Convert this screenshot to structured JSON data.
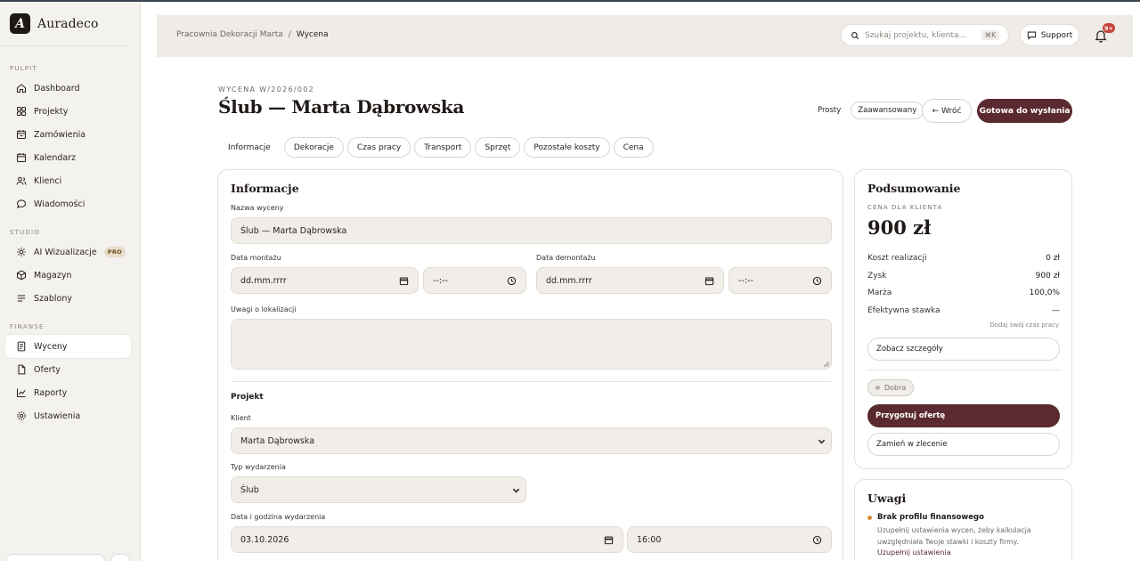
{
  "brand": {
    "logo_letter": "A",
    "name": "Auradeco"
  },
  "sidebar": {
    "sections": [
      {
        "label": "PULPIT",
        "items": [
          {
            "label": "Dashboard",
            "icon": "home-icon"
          },
          {
            "label": "Projekty",
            "icon": "grid-icon"
          },
          {
            "label": "Zamówienia",
            "icon": "box-icon"
          },
          {
            "label": "Kalendarz",
            "icon": "calendar-icon"
          },
          {
            "label": "Klienci",
            "icon": "users-icon"
          },
          {
            "label": "Wiadomości",
            "icon": "chat-icon"
          }
        ]
      },
      {
        "label": "STUDIO",
        "items": [
          {
            "label": "AI Wizualizacje",
            "icon": "sparkle-icon",
            "badge": "PRO"
          },
          {
            "label": "Magazyn",
            "icon": "package-icon"
          },
          {
            "label": "Szablony",
            "icon": "lines-icon"
          }
        ]
      },
      {
        "label": "FINANSE",
        "items": [
          {
            "label": "Wyceny",
            "icon": "document-icon",
            "active": true
          },
          {
            "label": "Oferty",
            "icon": "file-icon"
          },
          {
            "label": "Raporty",
            "icon": "chart-icon"
          },
          {
            "label": "Ustawienia",
            "icon": "gear-icon"
          }
        ]
      }
    ]
  },
  "header": {
    "breadcrumb": [
      "Pracownia Dekoracji Marta",
      "Wycena"
    ],
    "breadcrumb_sep": "/",
    "search_placeholder": "Szukaj projektu, klienta...",
    "search_kbd": "⌘K",
    "support_label": "Support",
    "notification_badge": "9+"
  },
  "page": {
    "eyebrow": "WYCENA W/2026/002",
    "title": "Ślub — Marta Dąbrowska",
    "mode_simple": "Prosty",
    "mode_advanced": "Zaawansowany",
    "back_label": "← Wróć",
    "ready_label": "Gotowa do wysłania"
  },
  "tabs": [
    "Informacje",
    "Dekoracje",
    "Czas pracy",
    "Transport",
    "Sprzęt",
    "Pozostałe koszty",
    "Cena"
  ],
  "form": {
    "section_title": "Informacje",
    "name_label": "Nazwa wyceny",
    "name_value": "Ślub — Marta Dąbrowska",
    "mount_label": "Data montażu",
    "mount_date": "dd.mm.rrrr",
    "mount_time": "--:--",
    "dismount_label": "Data demontażu",
    "dismount_date": "dd.mm.rrrr",
    "dismount_time": "--:--",
    "location_label": "Uwagi o lokalizacji",
    "project_heading": "Projekt",
    "client_label": "Klient",
    "client_value": "Marta Dąbrowska",
    "event_type_label": "Typ wydarzenia",
    "event_type_value": "Ślub",
    "event_date_label": "Data i godzina wydarzenia",
    "event_date_value": "03.10.2026",
    "event_time_value": "16:00"
  },
  "summary": {
    "title": "Podsumowanie",
    "price_label": "CENA DLA KLIENTA",
    "price_value": "900 zł",
    "rows": [
      {
        "label": "Koszt realizacji",
        "value": "0 zł"
      },
      {
        "label": "Zysk",
        "value": "900 zł"
      },
      {
        "label": "Marża",
        "value": "100,0%"
      },
      {
        "label": "Efektywna stawka",
        "value": "—"
      }
    ],
    "hint": "Dodaj swój czas pracy",
    "details_button": "Zobacz szczegóły",
    "quality_pill": "Dobra",
    "prepare_offer_button": "Przygotuj ofertę",
    "convert_button": "Zamień w zlecenie"
  },
  "notes": {
    "title": "Uwagi",
    "item_title": "Brak profilu finansowego",
    "item_body": "Uzupełnij ustawienia wycen, żeby kalkulacja uwzględniała Twoje stawki i koszty firmy.",
    "item_link": "Uzupełnij ustawienia"
  },
  "colors": {
    "accent": "#5b2a30",
    "sidebar_bg": "#f4f2ef",
    "header_bg": "#efebe6",
    "field_bg": "#f1ede8",
    "badge": "#c8443f"
  }
}
